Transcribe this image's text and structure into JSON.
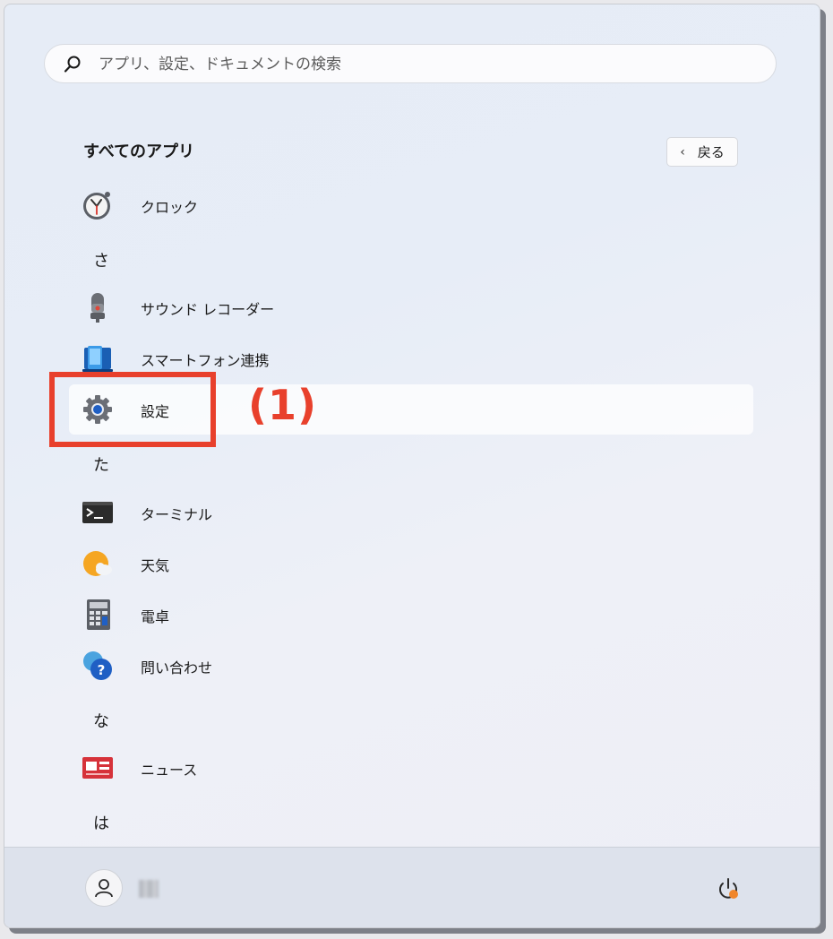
{
  "search": {
    "placeholder": "アプリ、設定、ドキュメントの検索"
  },
  "header": {
    "title": "すべてのアプリ",
    "back_label": "戻る"
  },
  "apps": [
    {
      "label": "クロック",
      "icon": "clock-icon"
    },
    {
      "label": "サウンド レコーダー",
      "icon": "microphone-icon"
    },
    {
      "label": "スマートフォン連携",
      "icon": "phone-link-icon"
    },
    {
      "label": "設定",
      "icon": "gear-icon",
      "selected": true
    },
    {
      "label": "ターミナル",
      "icon": "terminal-icon"
    },
    {
      "label": "天気",
      "icon": "weather-icon"
    },
    {
      "label": "電卓",
      "icon": "calculator-icon"
    },
    {
      "label": "問い合わせ",
      "icon": "help-icon"
    },
    {
      "label": "ニュース",
      "icon": "news-icon"
    }
  ],
  "letters": [
    "さ",
    "た",
    "な",
    "は"
  ],
  "annotation": {
    "label": "(1)",
    "color": "#e8402c"
  },
  "footer": {
    "power_icon": "power-icon",
    "badge_color": "#f0862b"
  }
}
